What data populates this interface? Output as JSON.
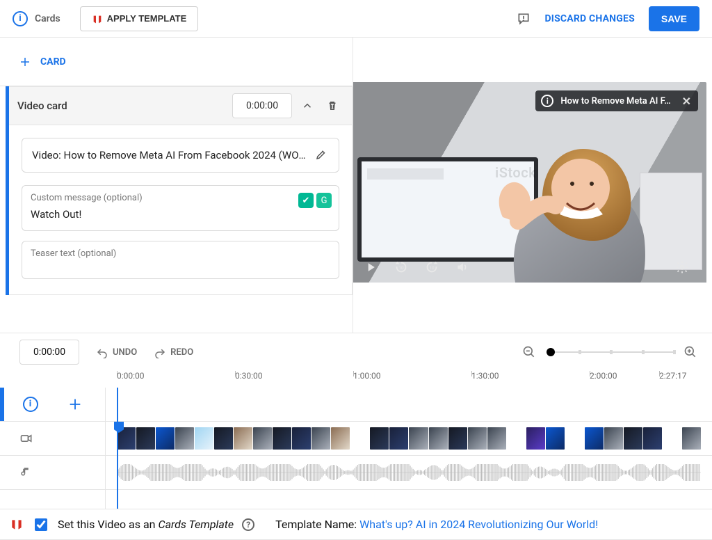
{
  "topbar": {
    "title": "Cards",
    "apply_template": "APPLY TEMPLATE",
    "discard": "DISCARD CHANGES",
    "save": "SAVE"
  },
  "left": {
    "add_card": "CARD",
    "card": {
      "title": "Video card",
      "time": "0:00:00",
      "video_label_prefix": "Video: ",
      "video_title": "How to Remove Meta AI From Facebook 2024 (WORKI…",
      "custom_label": "Custom message (optional)",
      "custom_value": "Watch Out!",
      "teaser_label": "Teaser text (optional)"
    }
  },
  "preview": {
    "pill_text": "How to Remove Meta AI F…",
    "watermark": "iStock"
  },
  "timeline": {
    "time": "0:00:00",
    "undo": "UNDO",
    "redo": "REDO",
    "marks": [
      "0:00:00",
      "0:30:00",
      "1:00:00",
      "1:30:00",
      "2:00:00",
      "2:27:17"
    ]
  },
  "footer": {
    "label_pre": "Set this Video as an ",
    "label_ital": "Cards Template",
    "tmpl_label": "Template Name: ",
    "tmpl_name": "What's up? AI in 2024 Revolutionizing Our World!"
  }
}
